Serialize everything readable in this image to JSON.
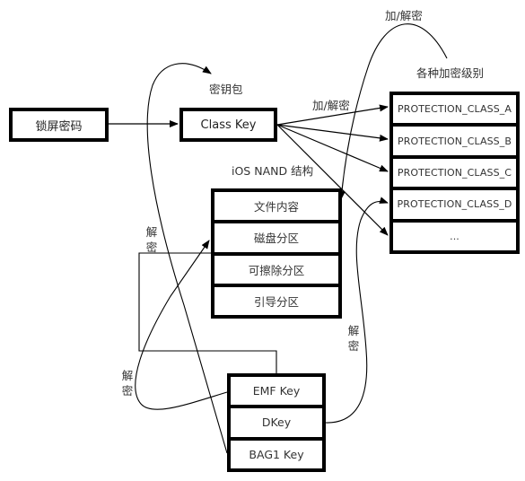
{
  "diagram": {
    "nodes": {
      "lock_password": "锁屏密码",
      "class_key": "Class Key"
    },
    "protection_classes": {
      "title": "各种加密级别",
      "rows": [
        "PROTECTION_CLASS_A",
        "PROTECTION_CLASS_B",
        "PROTECTION_CLASS_C",
        "PROTECTION_CLASS_D",
        "..."
      ]
    },
    "nand": {
      "title": "iOS NAND 结构",
      "rows": [
        "文件内容",
        "磁盘分区",
        "可擦除分区",
        "引导分区"
      ]
    },
    "keys": {
      "rows": [
        "EMF Key",
        "DKey",
        "BAG1 Key"
      ]
    },
    "edge_labels": {
      "keybag": "密钥包",
      "class_key_encrypt": "加/解密",
      "file_encrypt": "加/解密",
      "bag1_decrypt": "解密",
      "emf_decrypt": "解密",
      "dkey_decrypt": "解密"
    },
    "colors": {
      "stroke": "#000000",
      "text": "#333333",
      "background": "#ffffff"
    }
  }
}
